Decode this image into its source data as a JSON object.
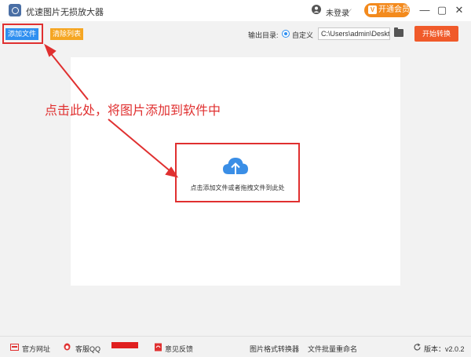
{
  "window": {
    "title": "优速图片无损放大器",
    "login_label": "未登录",
    "vip_label": "开通会员",
    "vip_icon_text": "V",
    "controls": [
      "—",
      "▢",
      "✕"
    ]
  },
  "toolbar": {
    "add_file_label": "添加文件",
    "clear_list_label": "清除列表",
    "output_dir_label": "输出目录:",
    "custom_option_label": "自定义",
    "output_path_value": "C:\\Users\\admin\\Deskto",
    "start_label": "开始转换"
  },
  "main": {
    "drop_hint": "点击添加文件或者拖拽文件到此处",
    "annotation": "点击此处，将图片添加到软件中"
  },
  "footer": {
    "website_label": "官方网址",
    "qq_label": "客服QQ",
    "feedback_label": "意见反馈",
    "format_converter_label": "图片格式转换器",
    "batch_rename_label": "文件批量重命名",
    "version_label": "版本：v2.0.2"
  },
  "colors": {
    "accent_blue": "#2f8ff0",
    "clear_orange": "#f5a623",
    "start_red": "#f05a2a",
    "annotation_red": "#e03030",
    "vip_orange": "#f38a1d"
  },
  "icons": {
    "app": "app-logo-icon",
    "user": "user-icon",
    "folder": "folder-icon",
    "cloud_upload": "cloud-upload-icon",
    "website": "website-icon",
    "qq": "qq-icon",
    "feedback": "feedback-icon",
    "refresh": "refresh-icon"
  }
}
